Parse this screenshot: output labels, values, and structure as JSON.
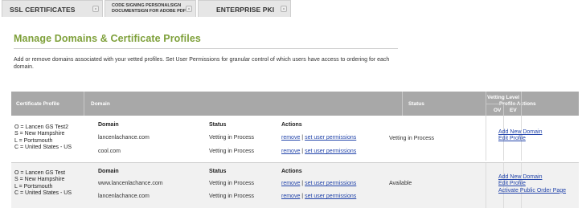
{
  "tabs": {
    "ssl": "SSL CERTIFICATES",
    "code_signing_line1": "CODE SIGNING  PERSONALSIGN",
    "code_signing_line2": "DOCUMENTSIGN FOR ADOBE PDF",
    "enterprise": "ENTERPRISE PKI"
  },
  "page": {
    "title": "Manage Domains & Certificate Profiles",
    "intro": "Add or remove domains associated with your vetted profiles. Set User Permissions for granular control of which users have access to ordering for each domain."
  },
  "table": {
    "headers": {
      "certificate_profile": "Certificate Profile",
      "domain": "Domain",
      "status": "Status",
      "vetting_level": "Vetting Level",
      "ov": "OV",
      "ev": "EV",
      "profile_actions": "Profile Actions"
    },
    "inner_headers": {
      "domain": "Domain",
      "status": "Status",
      "actions": "Actions"
    },
    "action_separator": "|",
    "rows": [
      {
        "profile": [
          "O = Lancen GS Test2",
          "S = New Hampshire",
          "L = Portsmouth",
          "C = United States - US"
        ],
        "domains": [
          {
            "domain": "lancenlachance.com",
            "status": "Vetting in Process",
            "remove": "remove",
            "permissions": "set user permissions"
          },
          {
            "domain": "cool.com",
            "status": "Vetting in Process",
            "remove": "remove",
            "permissions": "set user permissions"
          }
        ],
        "status": "Vetting in Process",
        "profile_actions": [
          "Add New Domain",
          "Edit Profile"
        ]
      },
      {
        "profile": [
          "O = Lancen GS Test",
          "S = New Hampshire",
          "L = Portsmouth",
          "C = United States - US"
        ],
        "domains": [
          {
            "domain": "www.lancenlachance.com",
            "status": "Vetting in Process",
            "remove": "remove",
            "permissions": "set user permissions"
          },
          {
            "domain": "lancenlachance.com",
            "status": "Vetting in Process",
            "remove": "remove",
            "permissions": "set user permissions"
          }
        ],
        "status": "Available",
        "profile_actions": [
          "Add New Domain",
          "Edit Profile",
          "Activate Public Order Page"
        ]
      }
    ]
  }
}
